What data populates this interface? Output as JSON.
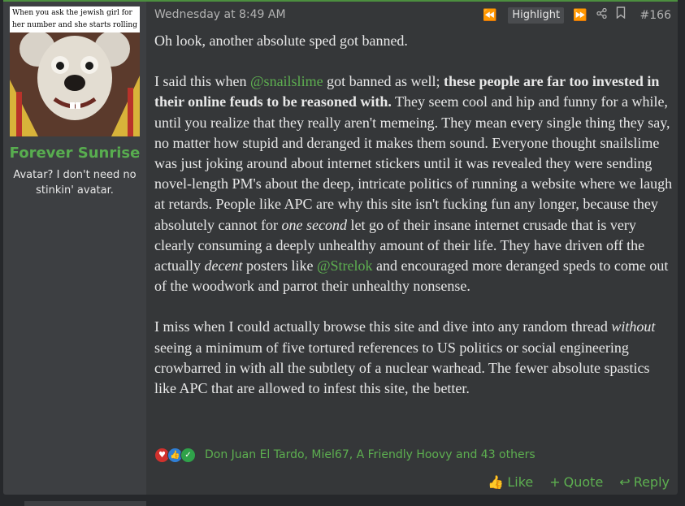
{
  "post": {
    "meme_caption": "When you ask the jewish girl for her number and she starts rolling up her sleev",
    "username": "Forever Sunrise",
    "user_title": "Avatar? I don't need no stinkin' avatar.",
    "time": "Wednesday at 8:49 AM",
    "tools": {
      "highlight_label": "Highlight",
      "post_number": "#166",
      "icons": [
        "prev-icon",
        "next-icon",
        "share-icon",
        "bookmark-icon"
      ]
    },
    "body": {
      "p1": "Oh look, another absolute sped got banned.",
      "p2": {
        "t1": "I said this when ",
        "mention1": "@snailslime",
        "t2": " got banned as well; ",
        "bold": "these people are far too invested in their online feuds to be reasoned with.",
        "t3": " They seem cool and hip and funny for a while, until you realize that they really aren't memeing. They mean every single thing they say, no matter how stupid and deranged it makes them sound. Everyone thought snailslime was just joking around about internet stickers until it was revealed they were sending novel-length PM's about the deep, intricate politics of running a website where we laugh at retards. People like APC are why this site isn't fucking fun any longer, because they absolutely cannot for ",
        "em1": "one second",
        "t4": " let go of their insane internet crusade that is very clearly consuming a deeply unhealthy amount of their life. They have driven off the actually ",
        "em2": "decent",
        "t5": " posters like ",
        "mention2": "@Strelok",
        "t6": " and encouraged more deranged speds to come out of the woodwork and parrot their unhealthy nonsense."
      },
      "p3": {
        "t1": "I miss when I could actually browse this site and dive into any random thread ",
        "em": "without",
        "t2": " seeing a minimum of five tortured references to US politics or social engineering crowbarred in with all the subtlety of a nuclear warhead. The fewer absolute spastics like APC that are allowed to infest this site, the better."
      }
    },
    "reactions": {
      "icons": [
        "heart-icon",
        "thumbs-up-icon",
        "checkmark-icon"
      ],
      "summary": "Don Juan El Tardo, Miel67, A Friendly Hoovy and 43 others"
    },
    "actions": {
      "like": "Like",
      "quote": "Quote",
      "reply": "Reply"
    }
  },
  "colors": {
    "accent": "#58ad4f",
    "background": "#26282b",
    "post_bg": "#353739",
    "user_col_bg": "#3d3f42"
  }
}
